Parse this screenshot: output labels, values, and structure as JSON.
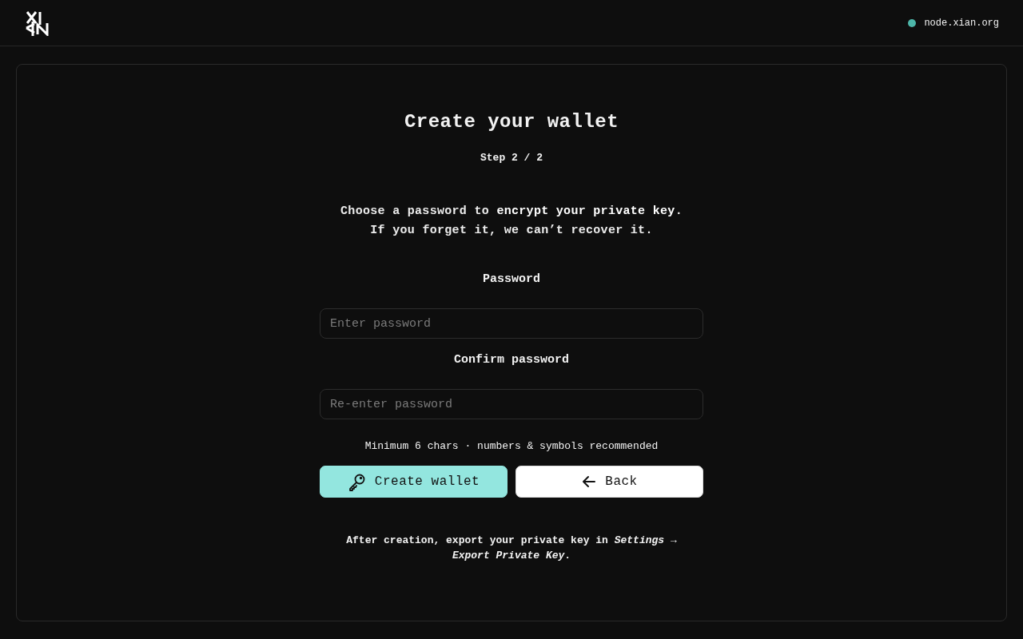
{
  "header": {
    "node": {
      "label": "node.xian.org",
      "online": true
    }
  },
  "card": {
    "title": "Create your wallet",
    "step": "Step 2 / 2",
    "description": [
      "Choose a password to **encrypt your private key**.",
      "If you forget it, we can’t recover it."
    ],
    "fields": [
      {
        "label": "Password",
        "placeholder": "Enter password"
      },
      {
        "label": "Confirm password",
        "placeholder": "Re-enter password"
      }
    ],
    "hint": "Minimum 6 chars · numbers & symbols recommended",
    "buttons": [
      {
        "kind": "primary",
        "label": "Create wallet"
      },
      {
        "kind": "secondary",
        "label": "Back"
      }
    ],
    "footnote": "After creation, export your private key in *Settings* → *Export Private Key*."
  }
}
